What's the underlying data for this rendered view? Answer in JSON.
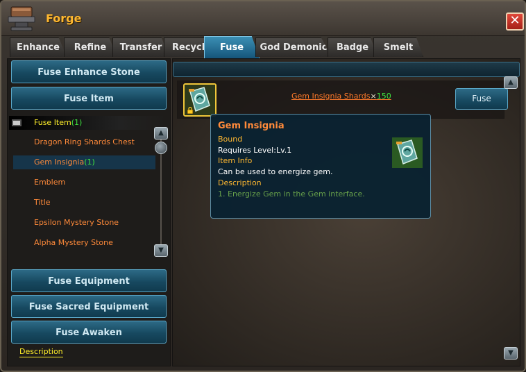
{
  "window": {
    "title": "Forge",
    "close_glyph": "✕"
  },
  "tabs": [
    {
      "label": "Enhance"
    },
    {
      "label": "Refine"
    },
    {
      "label": "Transfer"
    },
    {
      "label": "Recycle"
    },
    {
      "label": "Fuse"
    },
    {
      "label": "God Demonic"
    },
    {
      "label": "Badge"
    },
    {
      "label": "Smelt"
    }
  ],
  "active_tab": "Fuse",
  "sidebar": {
    "buttons": {
      "fuse_enhance_stone": "Fuse Enhance Stone",
      "fuse_item": "Fuse Item",
      "fuse_equipment": "Fuse Equipment",
      "fuse_sacred_equipment": "Fuse Sacred Equipment",
      "fuse_awaken": "Fuse Awaken"
    },
    "group": {
      "label": "Fuse Item",
      "count": "(1)"
    },
    "items": [
      {
        "label": "Dragon Ring Shards Chest",
        "count": ""
      },
      {
        "label": "Gem Insignia",
        "count": "(1)"
      },
      {
        "label": "Emblem",
        "count": ""
      },
      {
        "label": "Title",
        "count": ""
      },
      {
        "label": "Epsilon Mystery Stone",
        "count": ""
      },
      {
        "label": "Alpha Mystery Stone",
        "count": ""
      }
    ],
    "selected_item": "Gem Insignia",
    "description_link": "Description"
  },
  "main": {
    "recipe": {
      "material_name": "Gem Insignia Shards",
      "multiplier": "×",
      "quantity": "150",
      "fuse_button": "Fuse"
    },
    "tooltip": {
      "title": "Gem Insignia",
      "bound": "Bound",
      "requires_level": "Requires Level:Lv.1",
      "item_info_heading": "Item Info",
      "item_info_text": "Can be used to energize gem.",
      "description_heading": "Description",
      "description_text": "1. Energize Gem in the Gem interface."
    }
  },
  "colors": {
    "title_gold": "#ffb830",
    "item_orange": "#ff8a3a",
    "count_green": "#3fe53f",
    "group_yellow": "#ffef2a",
    "button_teal": "#174960",
    "tab_active": "#15557a"
  },
  "icons": [
    "anvil-icon",
    "close-icon",
    "minus-icon",
    "scroll-up-icon",
    "scroll-down-icon",
    "gem-insignia-icon",
    "lock-icon"
  ]
}
